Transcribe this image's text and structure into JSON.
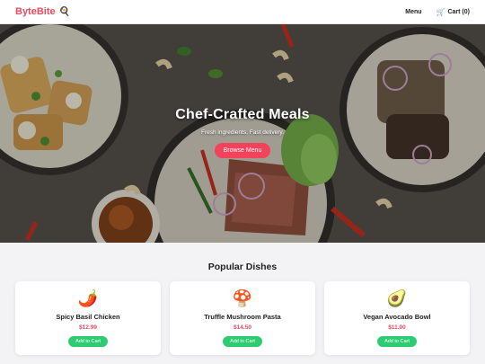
{
  "header": {
    "brand": "ByteBite",
    "brand_icon": "🍳",
    "nav": {
      "menu": "Menu",
      "cart_icon": "🛒",
      "cart": "Cart (0)"
    }
  },
  "hero": {
    "title": "Chef-Crafted Meals",
    "subtitle": "Fresh ingredients. Fast delivery.",
    "cta": "Browse Menu"
  },
  "popular": {
    "title": "Popular Dishes",
    "dishes": [
      {
        "icon": "🌶️",
        "name": "Spicy Basil Chicken",
        "price": "$12.99",
        "button": "Add to Cart"
      },
      {
        "icon": "🍄",
        "name": "Truffle Mushroom Pasta",
        "price": "$14.50",
        "button": "Add to Cart"
      },
      {
        "icon": "🥑",
        "name": "Vegan Avocado Bowl",
        "price": "$11.00",
        "button": "Add to Cart"
      }
    ]
  },
  "colors": {
    "brand": "#e84a5f",
    "cta": "#f2435a",
    "add": "#2ecc71",
    "price": "#e8485c"
  }
}
